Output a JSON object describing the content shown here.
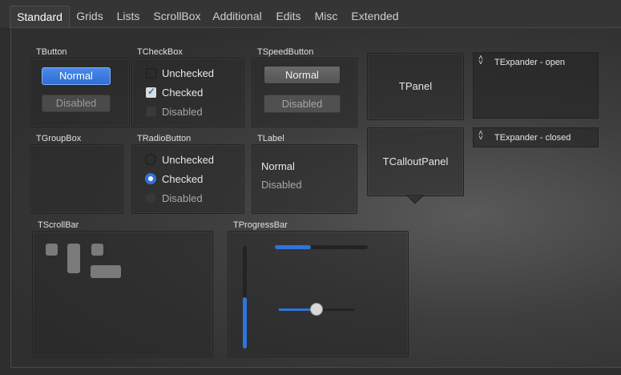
{
  "tabs": [
    "Standard",
    "Grids",
    "Lists",
    "ScrollBox",
    "Additional",
    "Edits",
    "Misc",
    "Extended"
  ],
  "groups": {
    "tbutton": {
      "title": "TButton",
      "normal": "Normal",
      "disabled": "Disabled"
    },
    "tcheckbox": {
      "title": "TCheckBox",
      "unchecked": "Unchecked",
      "checked": "Checked",
      "disabled": "Disabled"
    },
    "tspeedbutton": {
      "title": "TSpeedButton",
      "normal": "Normal",
      "disabled": "Disabled"
    },
    "tgroupbox": {
      "title": "TGroupBox"
    },
    "tradiobutton": {
      "title": "TRadioButton",
      "unchecked": "Unchecked",
      "checked": "Checked",
      "disabled": "Disabled"
    },
    "tlabel": {
      "title": "TLabel",
      "normal": "Normal",
      "disabled": "Disabled"
    },
    "tscrollbar": {
      "title": "TScrollBar"
    },
    "tprogressbar": {
      "title": "TProgressBar"
    }
  },
  "panels": {
    "tpanel": "TPanel",
    "tcallout": "TCalloutPanel"
  },
  "expanders": {
    "open": "TExpander - open",
    "closed": "TExpander - closed"
  },
  "progress": {
    "horizontal": 0.39,
    "vertical": 0.5,
    "trackbar": 0.5
  },
  "colors": {
    "accent": "#2f74dd"
  }
}
